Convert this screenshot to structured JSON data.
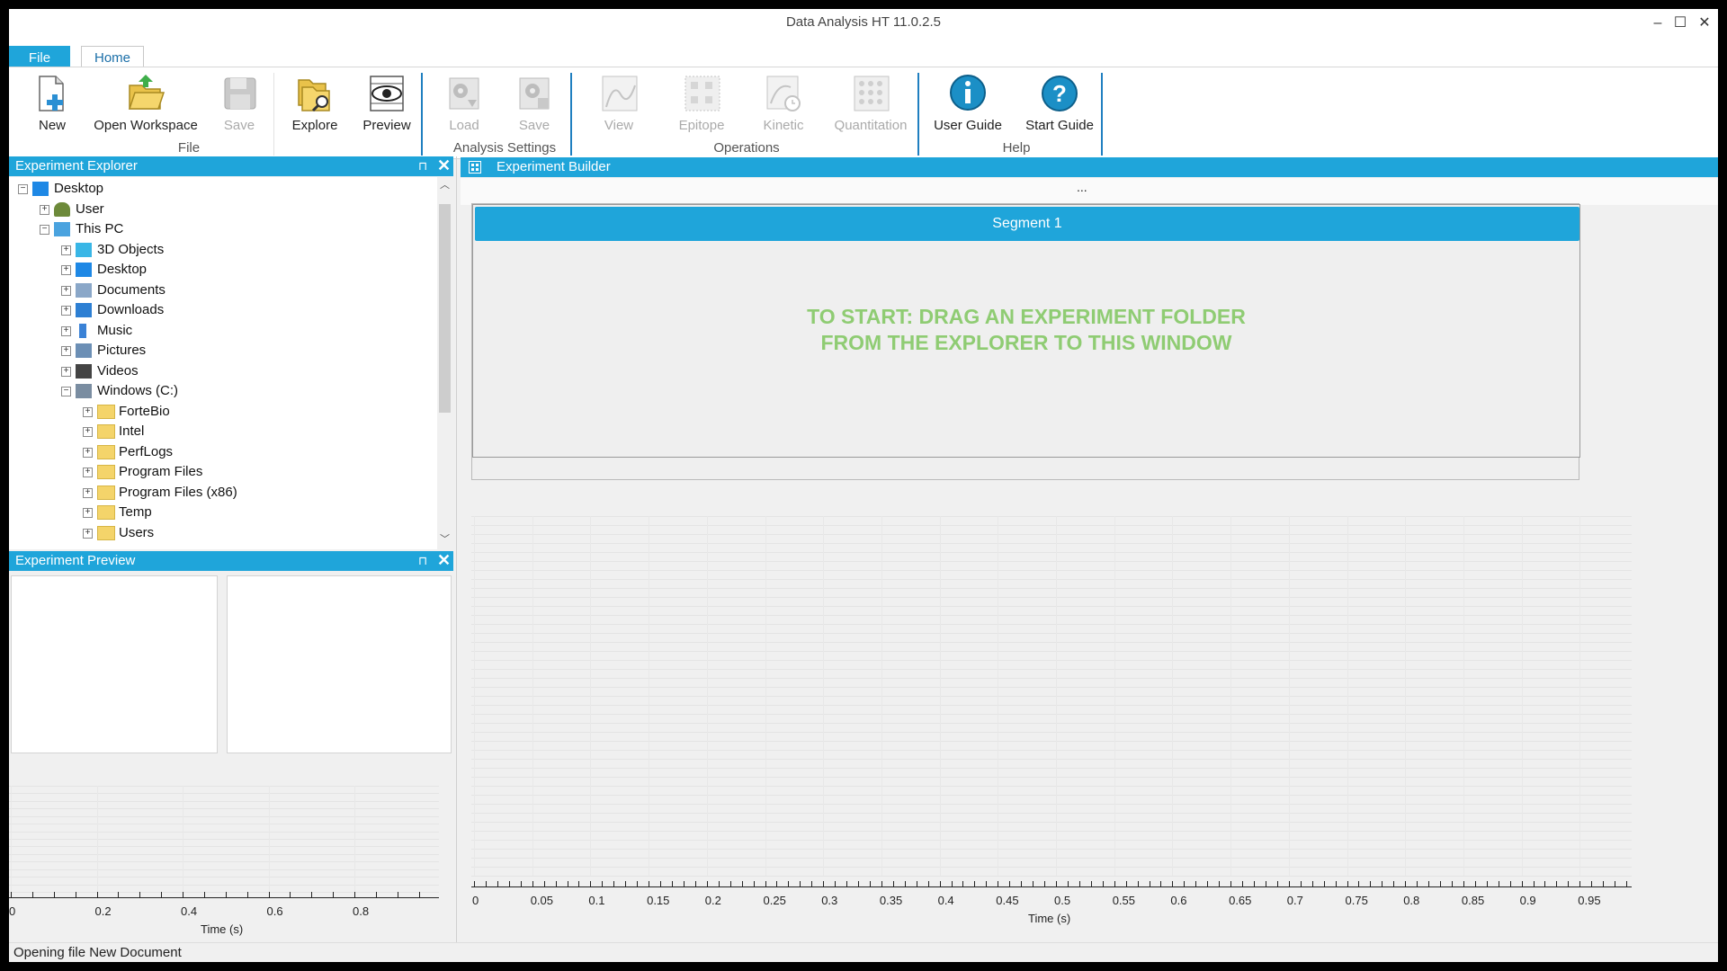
{
  "window": {
    "title": "Data Analysis HT 11.0.2.5",
    "minimize": "–",
    "maximize": "☐",
    "close": "✕"
  },
  "tabs": {
    "file": "File",
    "home": "Home"
  },
  "ribbon": {
    "file_group": {
      "label": "File",
      "new": "New",
      "open_workspace": "Open Workspace",
      "save": "Save",
      "explore": "Explore",
      "preview": "Preview"
    },
    "analysis_group": {
      "label": "Analysis Settings",
      "load": "Load",
      "save": "Save"
    },
    "operations_group": {
      "label": "Operations",
      "view": "View",
      "epitope": "Epitope",
      "kinetic": "Kinetic",
      "quantitation": "Quantitation"
    },
    "help_group": {
      "label": "Help",
      "user_guide": "User Guide",
      "start_guide": "Start Guide"
    }
  },
  "explorer": {
    "title": "Experiment Explorer",
    "pin": "⊓",
    "close": "✕",
    "items": [
      {
        "label": "Desktop",
        "level": 0,
        "icon": "monitor-icon",
        "expanded": true
      },
      {
        "label": "User",
        "level": 1,
        "icon": "user-icon",
        "expanded": false
      },
      {
        "label": "This PC",
        "level": 1,
        "icon": "computer-icon",
        "expanded": true
      },
      {
        "label": "3D Objects",
        "level": 2,
        "icon": "cube-icon",
        "expanded": false
      },
      {
        "label": "Desktop",
        "level": 2,
        "icon": "monitor-icon",
        "expanded": false
      },
      {
        "label": "Documents",
        "level": 2,
        "icon": "document-icon",
        "expanded": false
      },
      {
        "label": "Downloads",
        "level": 2,
        "icon": "download-icon",
        "expanded": false
      },
      {
        "label": "Music",
        "level": 2,
        "icon": "music-icon",
        "expanded": false
      },
      {
        "label": "Pictures",
        "level": 2,
        "icon": "picture-icon",
        "expanded": false
      },
      {
        "label": "Videos",
        "level": 2,
        "icon": "video-icon",
        "expanded": false
      },
      {
        "label": "Windows (C:)",
        "level": 2,
        "icon": "drive-icon",
        "expanded": true
      },
      {
        "label": "ForteBio",
        "level": 3,
        "icon": "folder-icon",
        "expanded": false
      },
      {
        "label": "Intel",
        "level": 3,
        "icon": "folder-icon",
        "expanded": false
      },
      {
        "label": "PerfLogs",
        "level": 3,
        "icon": "folder-icon",
        "expanded": false
      },
      {
        "label": "Program Files",
        "level": 3,
        "icon": "folder-icon",
        "expanded": false
      },
      {
        "label": "Program Files (x86)",
        "level": 3,
        "icon": "folder-icon",
        "expanded": false
      },
      {
        "label": "Temp",
        "level": 3,
        "icon": "folder-icon",
        "expanded": false
      },
      {
        "label": "Users",
        "level": 3,
        "icon": "folder-icon",
        "expanded": false
      }
    ]
  },
  "preview": {
    "title": "Experiment Preview",
    "pin": "⊓",
    "close": "✕",
    "x_ticks": [
      "0",
      "0.2",
      "0.4",
      "0.6",
      "0.8"
    ],
    "x_label": "Time (s)"
  },
  "builder": {
    "title": "Experiment Builder",
    "ellipsis": "...",
    "segment_label": "Segment 1",
    "drop_line1": "TO START: DRAG AN EXPERIMENT FOLDER",
    "drop_line2": "FROM THE EXPLORER TO THIS WINDOW",
    "x_ticks": [
      "0",
      "0.05",
      "0.1",
      "0.15",
      "0.2",
      "0.25",
      "0.3",
      "0.35",
      "0.4",
      "0.45",
      "0.5",
      "0.55",
      "0.6",
      "0.65",
      "0.7",
      "0.75",
      "0.8",
      "0.85",
      "0.9",
      "0.95"
    ],
    "x_label": "Time (s)"
  },
  "status": {
    "text": "Opening file New Document"
  },
  "colors": {
    "accent": "#1fa5da",
    "drop_text": "#8fcc73"
  }
}
